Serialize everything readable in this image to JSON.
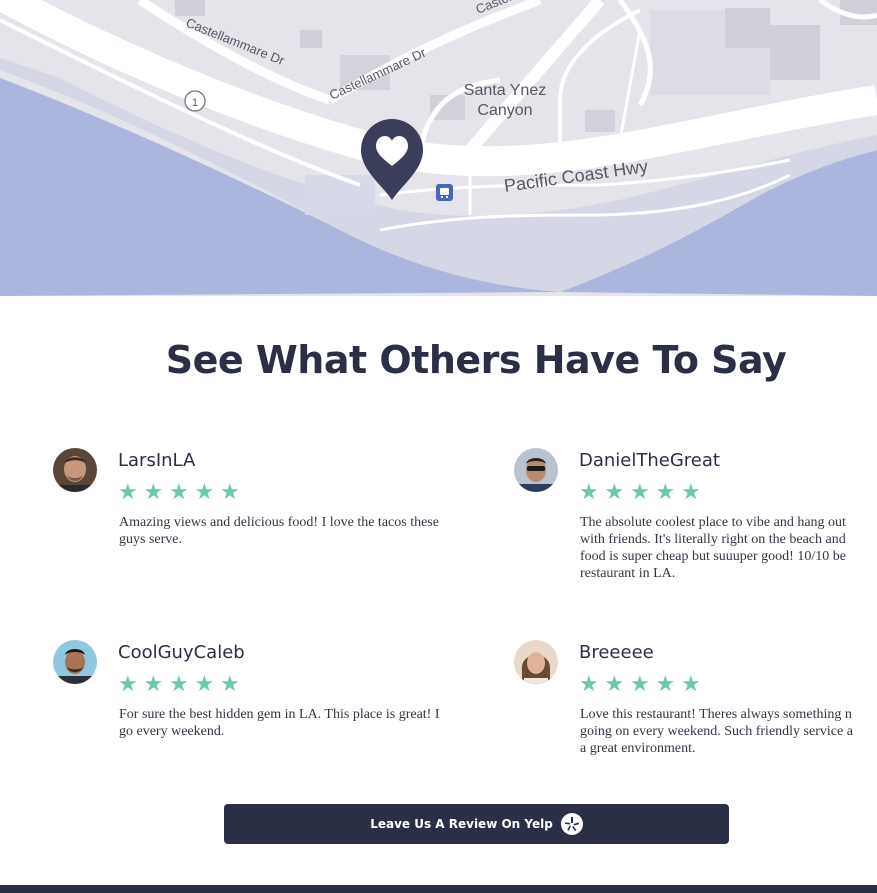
{
  "map": {
    "labels": {
      "castellammare_1": "Castellammare Dr",
      "castellammare_2": "Castellammare Dr",
      "castellammare_top": "Castel",
      "route": "1",
      "canyon_line1": "Santa Ynez",
      "canyon_line2": "Canyon",
      "highway": "Pacific Coast Hwy"
    },
    "pin_icon": "heart-location-pin-icon",
    "bus_icon": "bus-stop-icon"
  },
  "reviews_section": {
    "title": "See What Others Have To Say",
    "rating_color": "#6cc8ac",
    "reviews": [
      {
        "name": "LarsInLA",
        "stars": "★★★★★",
        "text": "Amazing views and delicious food! I love the tacos these guys serve."
      },
      {
        "name": "DanielTheGreat",
        "stars": "★★★★★",
        "text": "The absolute coolest place to vibe and hang out\nwith friends. It's literally right on the beach and\nfood is super cheap but suuuper good! 10/10 be\nrestaurant in LA."
      },
      {
        "name": "CoolGuyCaleb",
        "stars": "★★★★★",
        "text": "For sure the best hidden gem in LA. This place is great! I go every weekend."
      },
      {
        "name": "Breeeee",
        "stars": "★★★★★",
        "text": "Love this restaurant! Theres always something n\ngoing on every weekend. Such friendly service a\na great environment."
      }
    ]
  },
  "cta": {
    "label": "Leave Us A Review On Yelp",
    "icon": "yelp-icon"
  },
  "colors": {
    "primary": "#2b2f46",
    "star": "#6cc8ac",
    "water": "#aab6dd"
  }
}
